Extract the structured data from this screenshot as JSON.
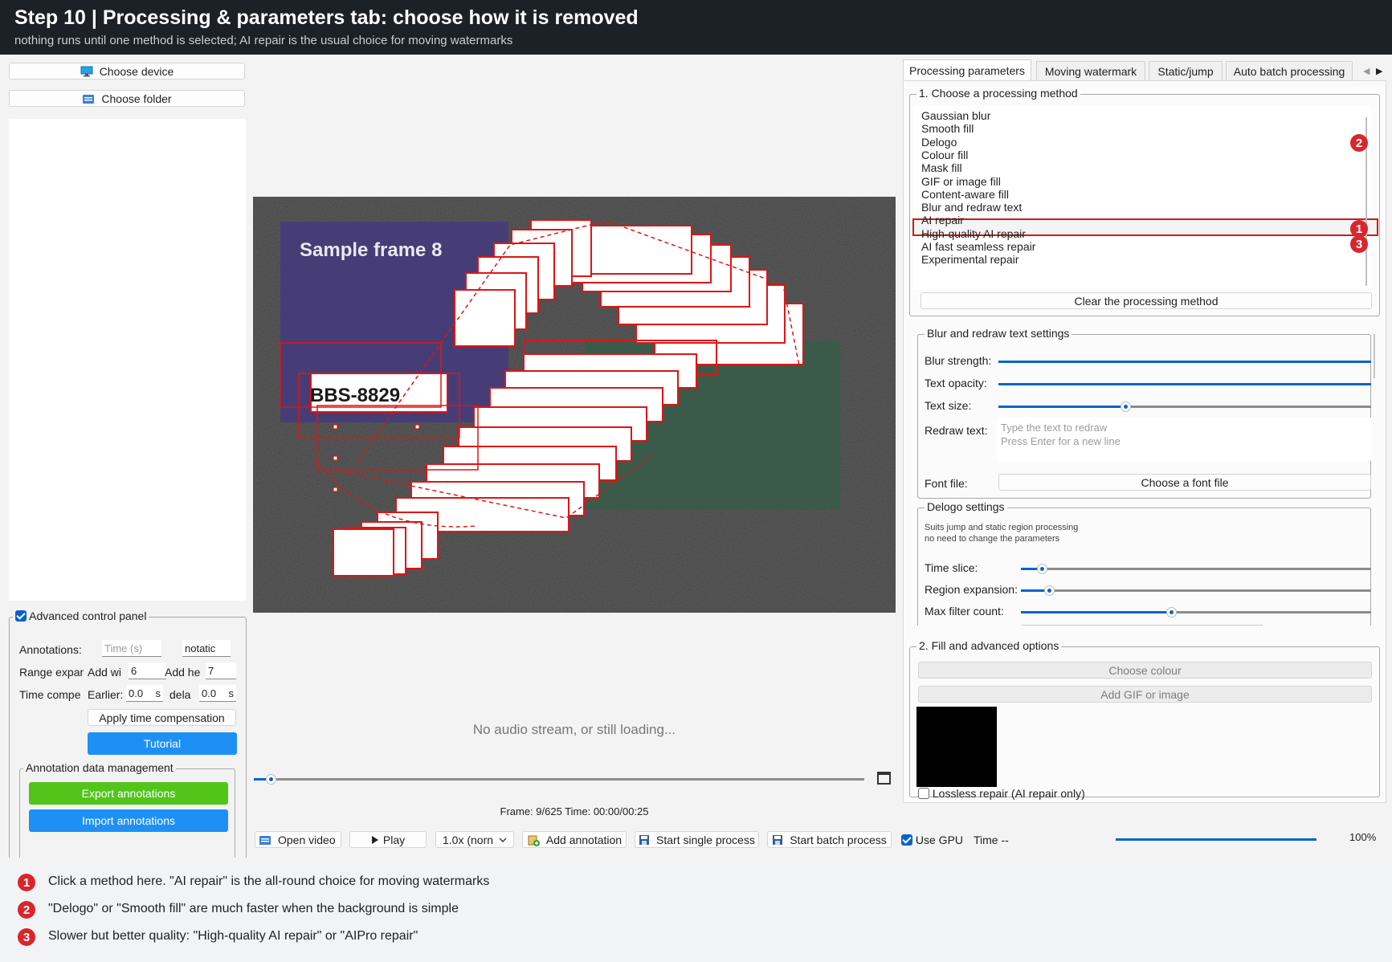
{
  "header": {
    "title": "Step 10 | Processing & parameters tab: choose how it is removed",
    "subtitle": "nothing runs until one method is selected; AI repair is the usual choice for moving watermarks"
  },
  "left": {
    "choose_device": "Choose device",
    "choose_folder": "Choose folder",
    "advanced_panel": "Advanced control panel",
    "annotations_label": "Annotations:",
    "time_placeholder": "Time (s)",
    "annotation_field": "notatic",
    "range_label": "Range expan",
    "add_w_label": "Add wi",
    "add_w_value": "6",
    "add_h_label": "Add he",
    "add_h_value": "7",
    "time_comp_label": "Time compe",
    "earlier_label": "Earlier:",
    "earlier_value": "0.0",
    "earlier_unit": "s",
    "delay_label": "dela",
    "delay_value": "0.0",
    "delay_unit": "s",
    "apply_time_comp": "Apply time compensation",
    "tutorial": "Tutorial",
    "annotation_mgmt": "Annotation data management",
    "export": "Export annotations",
    "import": "Import annotations"
  },
  "video": {
    "frame_title": "Sample frame 8",
    "plate_text": "BBS-8829",
    "no_audio": "No audio stream, or still loading...",
    "progress": 0.02,
    "frame_status": "Frame: 9/625  Time: 00:00/00:25"
  },
  "toolbar": {
    "open_video": "Open video",
    "play": "Play",
    "speed": "1.0x (norn",
    "add_annotation": "Add annotation",
    "start_single": "Start single process",
    "start_batch": "Start batch process",
    "use_gpu": "Use GPU",
    "time": "Time --",
    "percent": "100%",
    "overall_progress": 1.0
  },
  "right": {
    "tabs": [
      "Processing  parameters",
      "Moving watermark",
      "Static/jump",
      "Auto batch processing"
    ],
    "section1_title": "1. Choose a processing method",
    "methods": [
      "Gaussian blur",
      "Smooth fill",
      "Delogo",
      "Colour fill",
      "Mask fill",
      "GIF or image fill",
      " Content-aware fill",
      "Blur and redraw text",
      "AI repair",
      "High-quality AI repair",
      "AI fast seamless repair",
      "Experimental repair"
    ],
    "selected_method": "AI repair",
    "clear_method": "Clear the processing method",
    "blur_group": "Blur and redraw text settings",
    "blur_strength": "Blur strength:",
    "blur_strength_value": 1.0,
    "text_opacity": "Text opacity:",
    "text_opacity_value": 1.0,
    "text_size": "Text size:",
    "text_size_value": 0.34,
    "redraw_text": "Redraw text:",
    "redraw_ph1": "Type the text to redraw",
    "redraw_ph2": "Press Enter for a new line",
    "font_file": "Font file:",
    "choose_font": "Choose a font file",
    "delogo_group": "Delogo settings",
    "delogo_desc1": "Suits jump and static region processing",
    "delogo_desc2": "no need to change the parameters",
    "time_slice": "Time slice:",
    "time_slice_value": 0.06,
    "region_expansion": "Region expansion:",
    "region_expansion_value": 0.08,
    "max_filter": "Max filter count:",
    "max_filter_value": 0.43,
    "section2_title": "2. Fill and advanced options",
    "choose_colour": "Choose colour",
    "add_gif": "Add GIF or image",
    "lossless": "Lossless repair (AI repair only)",
    "fill_colour": "#000000"
  },
  "annotations": [
    {
      "num": "1",
      "text": "Click a method here. \"AI repair\" is the all-round choice for moving watermarks"
    },
    {
      "num": "2",
      "text": "\"Delogo\" or \"Smooth fill\" are much faster when the background is simple"
    },
    {
      "num": "3",
      "text": "Slower but better quality: \"High-quality AI repair\" or \"AIPro repair\""
    }
  ],
  "colors": {
    "accent": "#0a64c8",
    "badge": "#d9262c",
    "tutorial": "#1e90f5",
    "export": "#52c41a"
  }
}
